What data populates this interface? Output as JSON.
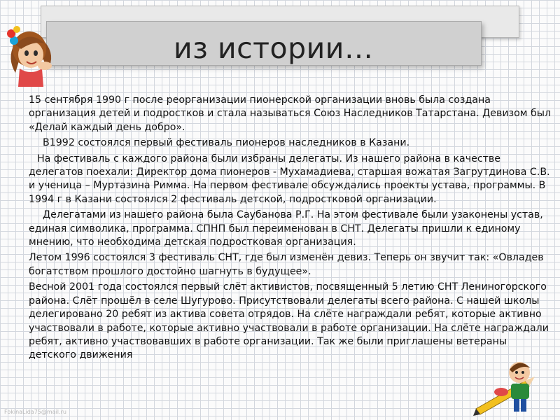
{
  "title": "из истории…",
  "paragraphs": [
    "15 сентября 1990 г после реорганизации пионерской организации вновь была создана организация детей и подростков и стала называться Союз Наследников Татарстана. Девизом был «Делай каждый день добро».",
    "В1992 состоялся первый фестиваль пионеров наследников в Казани.",
    "На фестиваль с каждого района были избраны делегаты. Из нашего района в качестве делегатов поехали: Директор дома пионеров - Мухамадиева, старшая вожатая Загрутдинова С.В. и ученица – Муртазина Римма. На первом фестивале обсуждались проекты устава, программы. В 1994 г в Казани состоялся 2 фестиваль детской, подростковой организации.",
    "Делегатами из нашего района была Саубанова Р.Г. На этом фестивале были узаконены устав, единая символика, программа. СПНП был переименован в СНТ. Делегаты пришли к единому мнению, что необходима детская подростковая организация.",
    "Летом 1996 состоялся 3 фестиваль СНТ, где был изменён девиз. Теперь он звучит так: «Овладев богатством прошлого достойно шагнуть в будущее».",
    "Весной 2001 года состоялся первый слёт активистов, посвященный 5 летию СНТ Лениногорского района. Слёт прошёл в селе Шугурово. Присутствовали делегаты всего района. С нашей школы делегировано 20 ребят из актива совета отрядов. На слёте награждали ребят, которые активно участвовали в работе, которые активно участвовали в работе организации. На слёте награждали ребят, активно участвовавших в работе организации. Так же были приглашены ветераны детского движения"
  ],
  "watermark": "FokinaLida75@mail.ru",
  "colors": {
    "background": "#fbfbfb",
    "grid": "#d3d7de",
    "banner_back": "#e9e9e9",
    "banner_front": "#d0d0d0",
    "text": "#111111"
  },
  "icons": [
    "cartoon-girl-icon",
    "cartoon-kid-with-pencil-icon"
  ]
}
